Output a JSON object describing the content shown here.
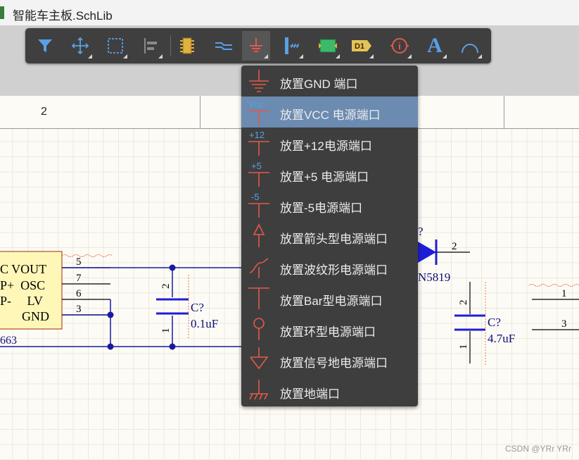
{
  "window": {
    "title": "智能车主板.SchLib"
  },
  "toolbar": {
    "buttons": [
      {
        "id": "filter",
        "icon": "filter-icon",
        "has_dropdown": false
      },
      {
        "id": "move",
        "icon": "move-icon",
        "has_dropdown": true
      },
      {
        "id": "select",
        "icon": "select-rect-icon",
        "has_dropdown": true
      },
      {
        "id": "align",
        "icon": "align-icon",
        "has_dropdown": true
      },
      {
        "id": "part",
        "icon": "component-icon",
        "has_dropdown": false
      },
      {
        "id": "wire",
        "icon": "wire-icon",
        "has_dropdown": false
      },
      {
        "id": "power",
        "icon": "ground-icon",
        "has_dropdown": true,
        "active": true
      },
      {
        "id": "harness",
        "icon": "harness-icon",
        "has_dropdown": true
      },
      {
        "id": "sheet",
        "icon": "sheet-symbol-icon",
        "has_dropdown": true
      },
      {
        "id": "netlabel",
        "icon": "net-label-icon",
        "has_dropdown": true
      },
      {
        "id": "directive",
        "icon": "directive-icon",
        "has_dropdown": true
      },
      {
        "id": "text",
        "icon": "text-icon",
        "has_dropdown": true
      },
      {
        "id": "arc",
        "icon": "arc-icon",
        "has_dropdown": true
      }
    ],
    "net_label_text": "D1",
    "text_glyph": "A"
  },
  "sheet_header": {
    "column_2": "2"
  },
  "menu": {
    "items": [
      {
        "label": "放置GND 端口",
        "icon": "gnd-port-icon"
      },
      {
        "label": "放置VCC 电源端口",
        "icon": "vcc-port-icon",
        "icon_text": "Vcc",
        "highlighted": true
      },
      {
        "label": "放置+12电源端口",
        "icon": "plus12-port-icon",
        "icon_text": "+12"
      },
      {
        "label": "放置+5 电源端口",
        "icon": "plus5-port-icon",
        "icon_text": "+5"
      },
      {
        "label": "放置-5电源端口",
        "icon": "minus5-port-icon",
        "icon_text": "-5"
      },
      {
        "label": "放置箭头型电源端口",
        "icon": "arrow-port-icon"
      },
      {
        "label": "放置波纹形电源端口",
        "icon": "wave-port-icon"
      },
      {
        "label": "放置Bar型电源端口",
        "icon": "bar-port-icon"
      },
      {
        "label": "放置环型电源端口",
        "icon": "circle-port-icon"
      },
      {
        "label": "放置信号地电源端口",
        "icon": "signal-ground-icon"
      },
      {
        "label": "放置地端口",
        "icon": "earth-port-icon"
      }
    ]
  },
  "schematic": {
    "ic": {
      "pins_left_labels": [
        "C VOUT",
        "P+  OSC",
        "P-     LV",
        "GND"
      ],
      "pin_numbers": [
        "5",
        "7",
        "6",
        "3"
      ],
      "designator": "663"
    },
    "cap1": {
      "designator": "C?",
      "value": "0.1uF",
      "pin_top": "2",
      "pin_bottom": "1"
    },
    "diode": {
      "designator": "?",
      "part": "N5819",
      "pin": "2"
    },
    "cap2": {
      "designator": "C?",
      "value": "4.7uF",
      "pin_top": "2",
      "pin_bottom": "1"
    },
    "right_pins": [
      "1",
      "3"
    ]
  },
  "watermark": "CSDN @YRr YRr",
  "colors": {
    "accent_red": "#e05a4a",
    "highlight": "#6b8bb1",
    "wire": "#1a1aa0",
    "cap_blue": "#1e1ed6"
  }
}
